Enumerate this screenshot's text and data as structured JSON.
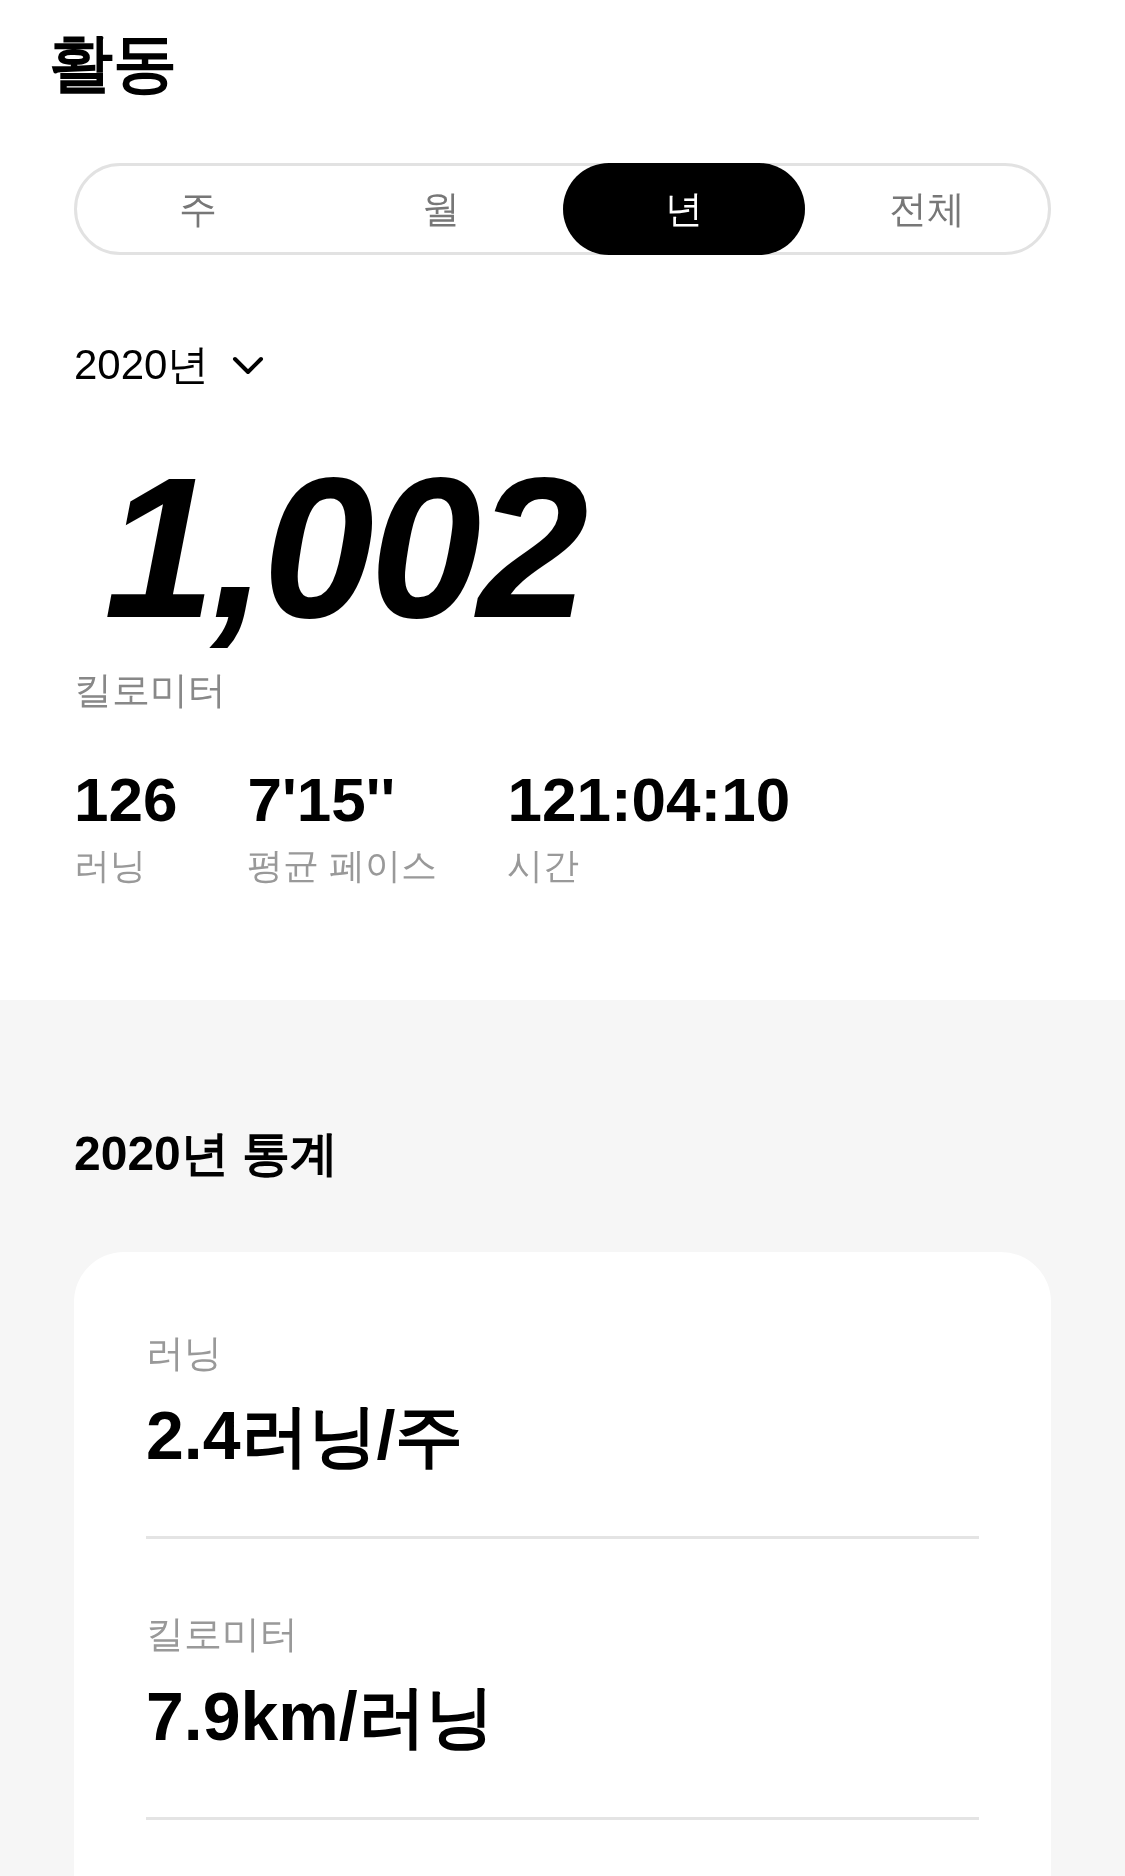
{
  "title": "활동",
  "tabs": [
    {
      "label": "주",
      "selected": false
    },
    {
      "label": "월",
      "selected": false
    },
    {
      "label": "년",
      "selected": true
    },
    {
      "label": "전체",
      "selected": false
    }
  ],
  "period": {
    "label": "2020년"
  },
  "total": {
    "value": "1,002",
    "unit": "킬로미터"
  },
  "stats": [
    {
      "value": "126",
      "label": "러닝"
    },
    {
      "value": "7'15''",
      "label": "평균 페이스"
    },
    {
      "value": "121:04:10",
      "label": "시간"
    }
  ],
  "summary": {
    "title": "2020년 통계",
    "items": [
      {
        "label": "러닝",
        "value": "2.4러닝/주"
      },
      {
        "label": "킬로미터",
        "value": "7.9km/러닝"
      }
    ]
  }
}
